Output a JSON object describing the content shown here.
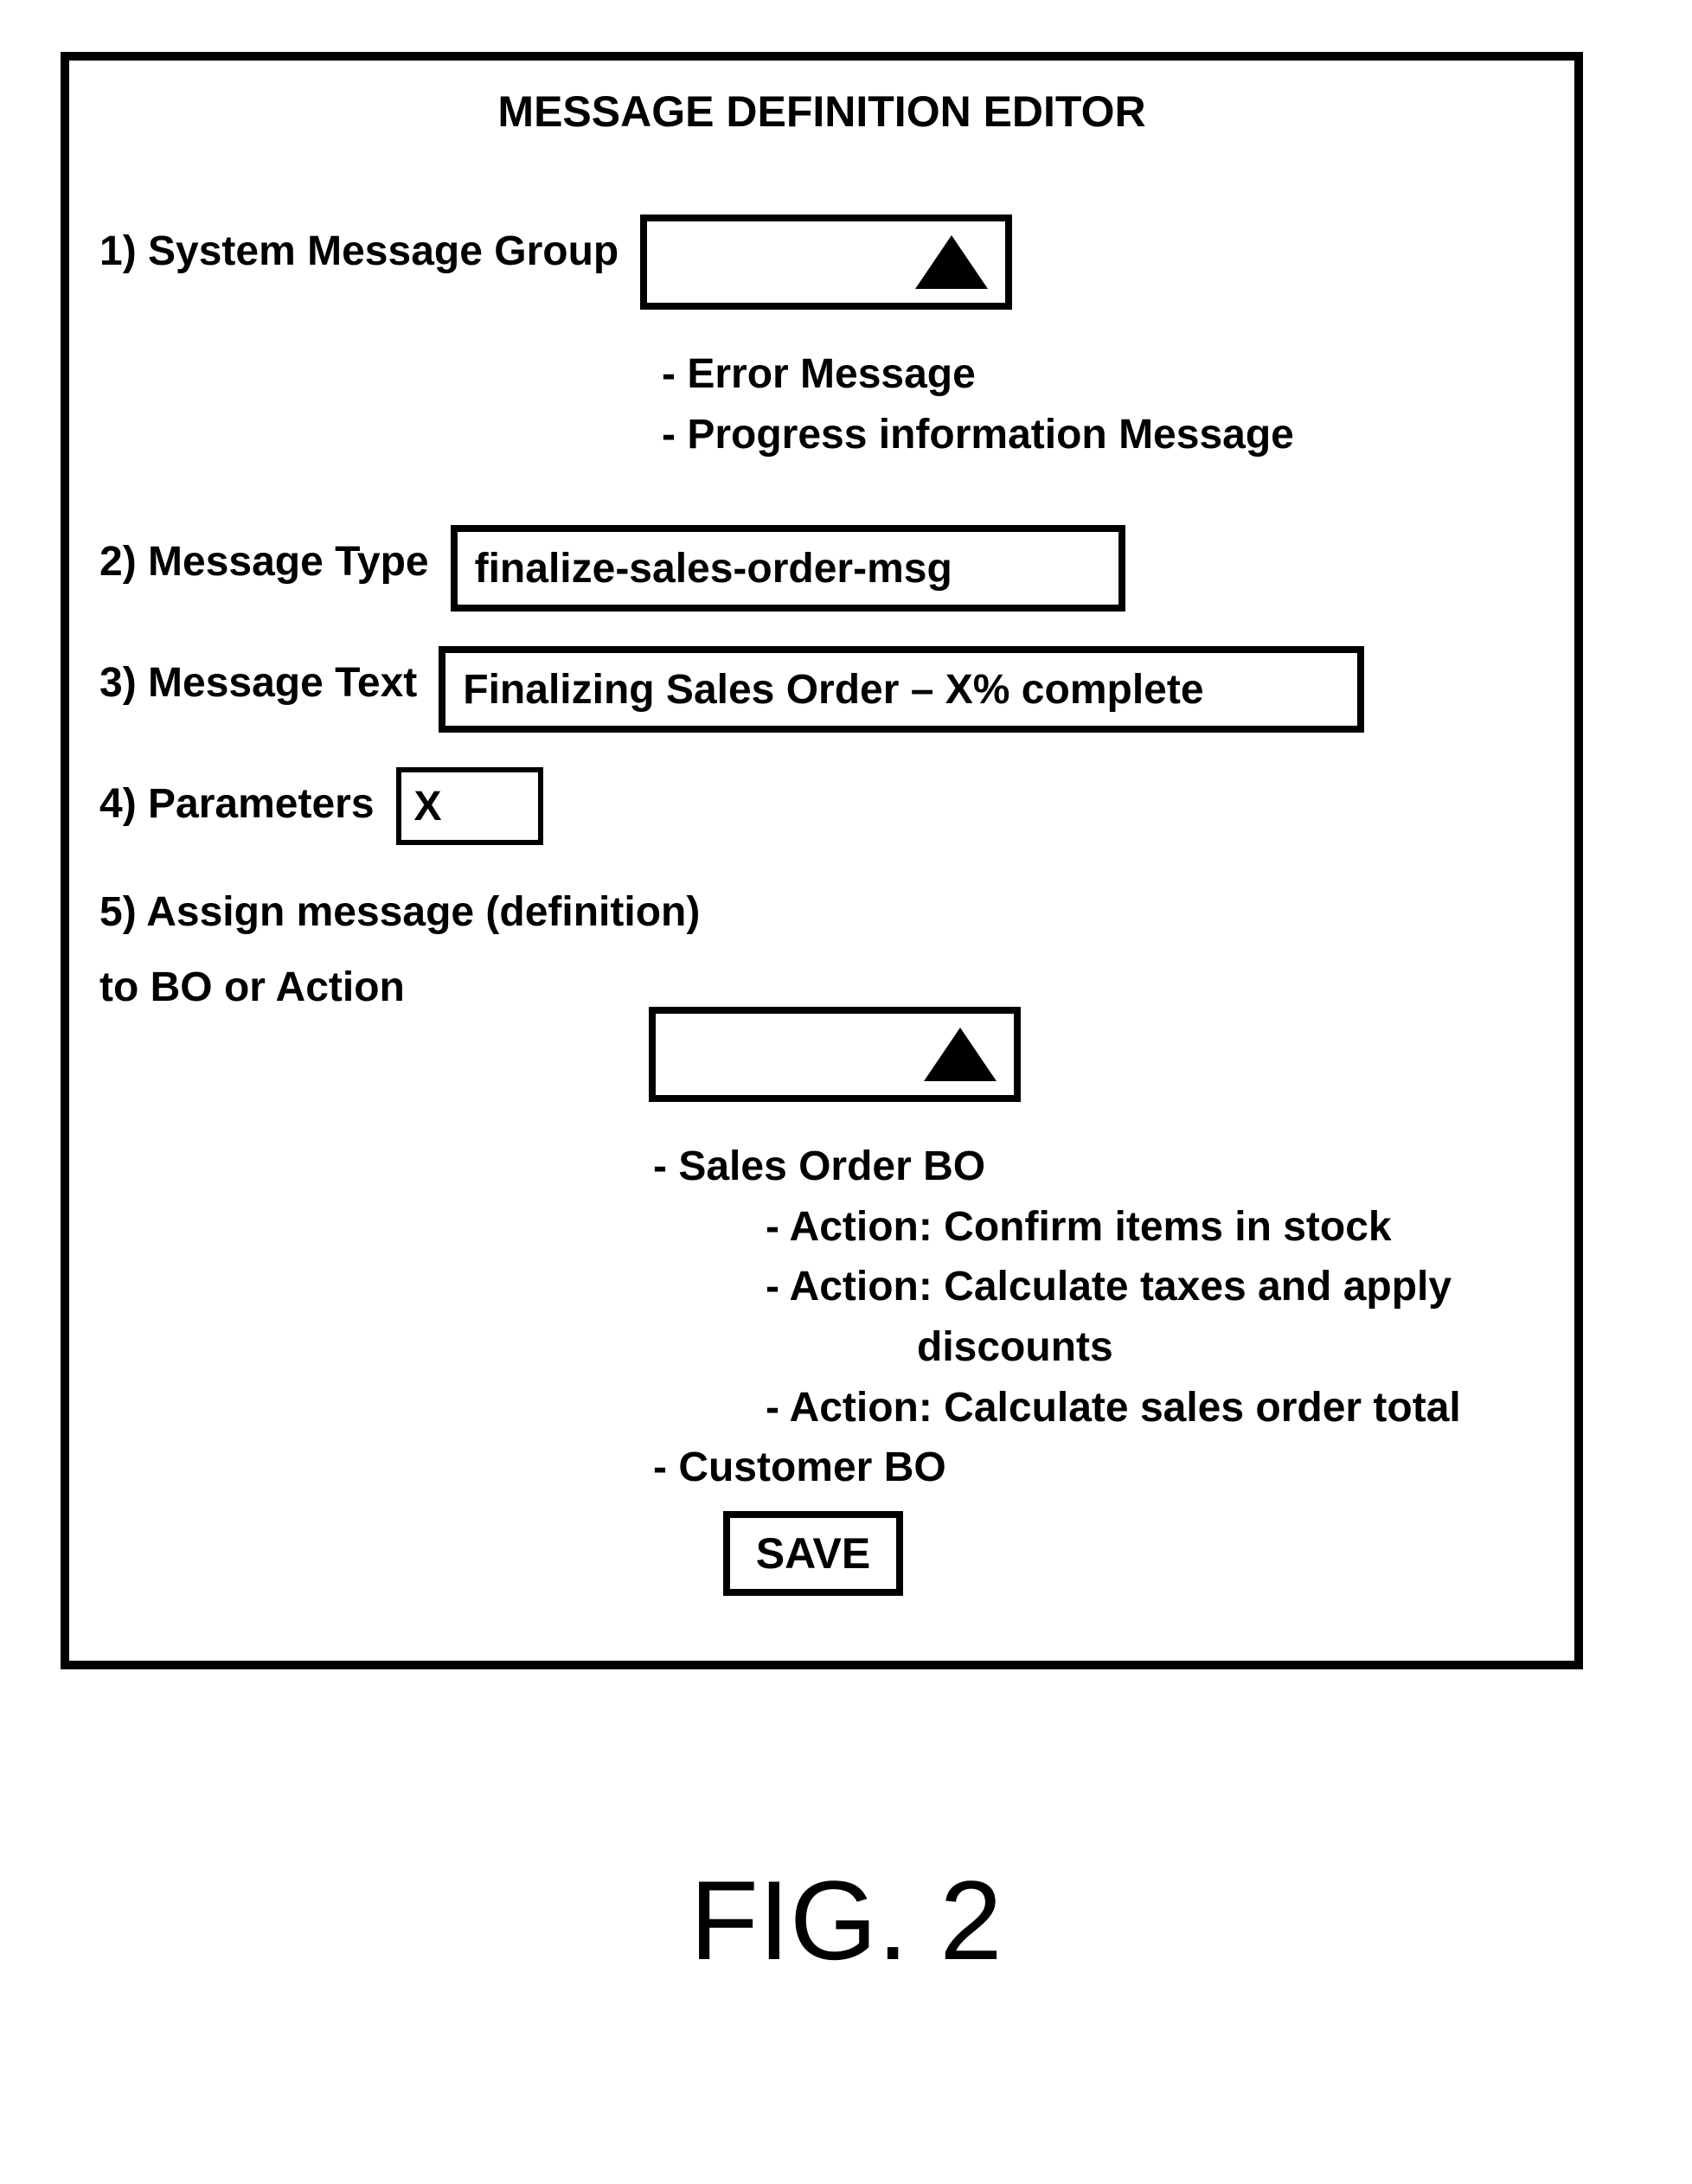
{
  "editor": {
    "title": "MESSAGE DEFINITION EDITOR",
    "fields": {
      "system_message_group": {
        "label": "1) System Message Group",
        "value": "",
        "options": [
          "- Error Message",
          "- Progress information Message"
        ]
      },
      "message_type": {
        "label": "2) Message Type",
        "value": "finalize-sales-order-msg"
      },
      "message_text": {
        "label": "3) Message Text",
        "value": "Finalizing Sales Order – X% complete"
      },
      "parameters": {
        "label": "4) Parameters",
        "value": "X"
      },
      "assign": {
        "label_line1": "5) Assign message (definition)",
        "label_line2": "to BO or Action",
        "value": "",
        "tree": {
          "item1": "- Sales Order BO",
          "item1_actions": [
            "- Action: Confirm items in stock",
            "- Action: Calculate taxes and apply",
            "discounts",
            "- Action: Calculate sales order total"
          ],
          "item2": "- Customer BO"
        }
      }
    },
    "save_label": "SAVE"
  },
  "figure_caption": "FIG. 2"
}
